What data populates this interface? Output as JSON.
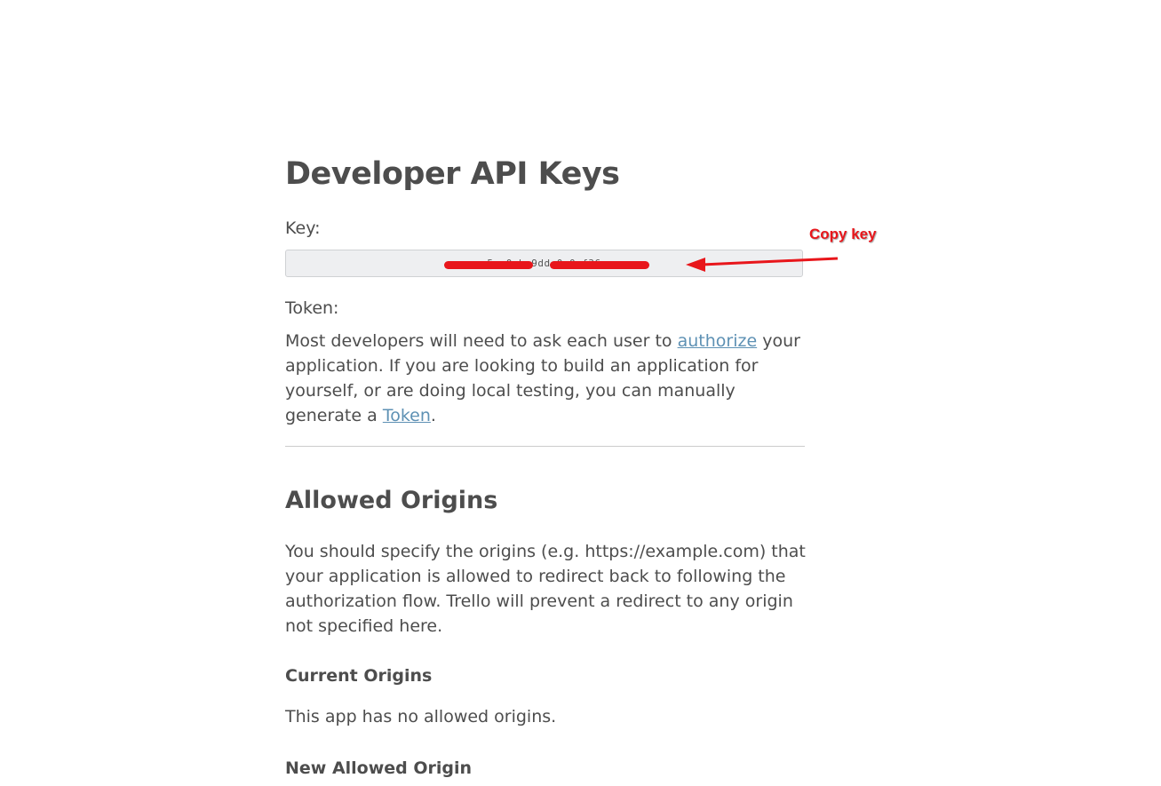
{
  "page": {
    "title": "Developer API Keys"
  },
  "key_section": {
    "label": "Key:",
    "value": "5a  0  b  9dd  0  0  f36"
  },
  "token_section": {
    "label": "Token:",
    "text_1": "Most developers will need to ask each user to ",
    "link_authorize": "authorize",
    "text_2": " your application. If you are looking to build an application for yourself, or are doing local testing, you can manually generate a ",
    "link_token": "Token",
    "text_3": "."
  },
  "origins_section": {
    "title": "Allowed Origins",
    "description": "You should specify the origins (e.g. https://example.com) that your application is allowed to redirect back to following the authorization flow. Trello will prevent a redirect to any origin not specified here.",
    "current_heading": "Current Origins",
    "empty_message": "This app has no allowed origins.",
    "new_heading": "New Allowed Origin"
  },
  "annotation": {
    "label": "Copy key",
    "color": "#e8161b"
  },
  "colors": {
    "text": "#4d4d4d",
    "link": "#5e91b4",
    "input_bg": "#eeeff1"
  }
}
